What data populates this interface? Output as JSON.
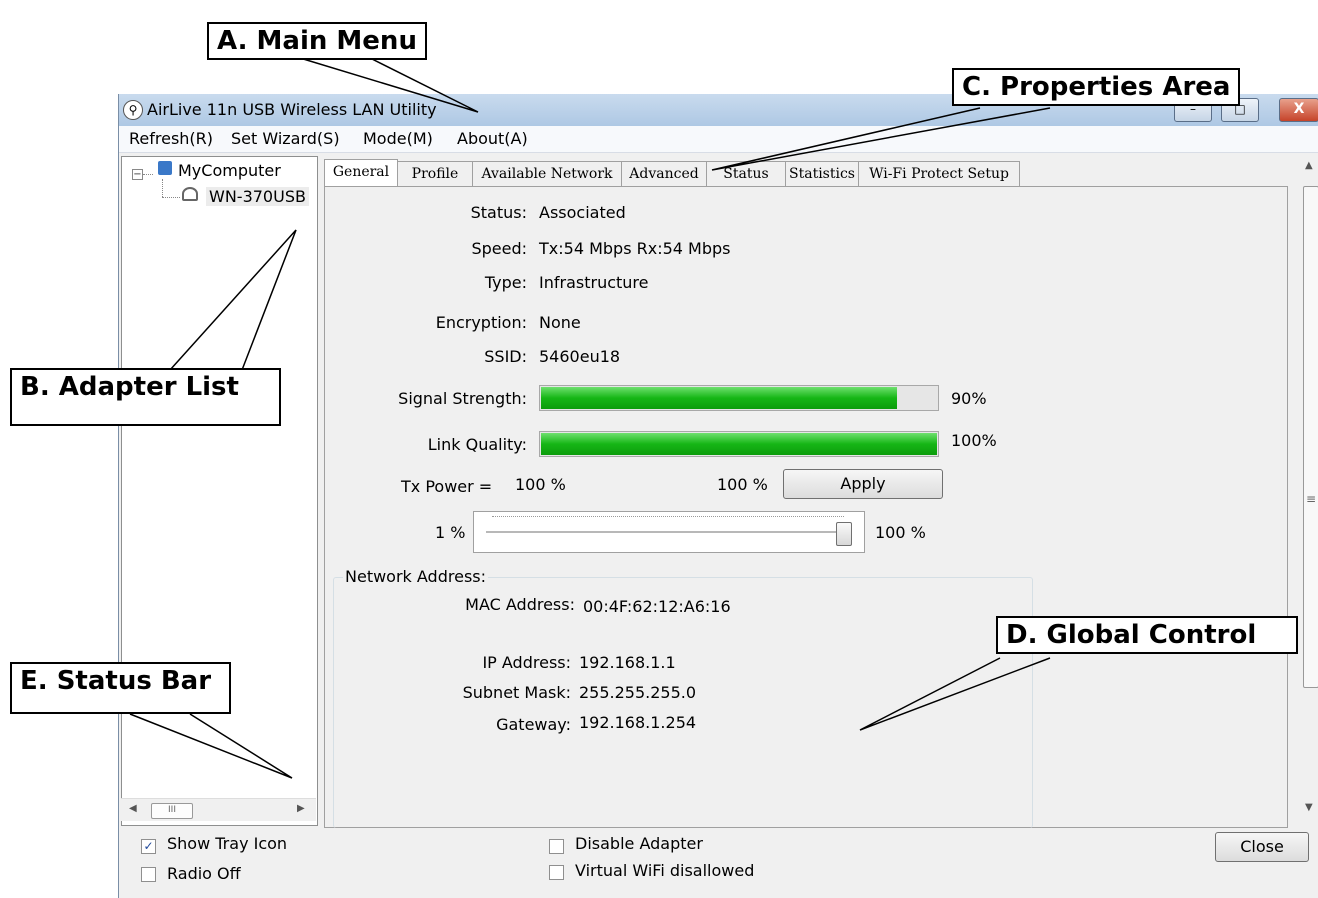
{
  "window": {
    "title": "AirLive 11n USB Wireless LAN Utility",
    "buttons": {
      "minimize": "–",
      "maximize": "□",
      "close": "X"
    }
  },
  "menu": [
    "Refresh(R)",
    "Set Wizard(S)",
    "Mode(M)",
    "About(A)"
  ],
  "tree": {
    "root": "MyComputer",
    "adapter": "WN-370USB",
    "scroll_thumb": "III"
  },
  "tabs": [
    "General",
    "Profile",
    "Available Network",
    "Advanced",
    "Status",
    "Statistics",
    "Wi-Fi Protect Setup"
  ],
  "general": {
    "status_label": "Status:",
    "status_value": "Associated",
    "speed_label": "Speed:",
    "speed_value": "Tx:54 Mbps Rx:54 Mbps",
    "type_label": "Type:",
    "type_value": "Infrastructure",
    "encryption_label": "Encryption:",
    "encryption_value": "None",
    "ssid_label": "SSID:",
    "ssid_value": "5460eu18",
    "signal_label": "Signal Strength:",
    "signal_text": "90%",
    "signal_level": 0.9,
    "link_label": "Link Quality:",
    "link_text": "100%",
    "link_level": 1.0,
    "txpower_label": "Tx Power =",
    "txpower_value": "100 %",
    "txpower_current": "100 %",
    "apply_label": "Apply",
    "slider_min": "1 %",
    "slider_max": "100 %",
    "slider_level": 1.0
  },
  "network": {
    "group_label": "Network Address:",
    "mac_label": "MAC Address:",
    "mac_value": "00:4F:62:12:A6:16",
    "ip_label": "IP Address:",
    "ip_value": "192.168.1.1",
    "subnet_label": "Subnet Mask:",
    "subnet_value": "255.255.255.0",
    "gateway_label": "Gateway:",
    "gateway_value": "192.168.1.254"
  },
  "global": {
    "show_tray": "Show Tray Icon",
    "show_tray_checked": true,
    "radio_off": "Radio Off",
    "radio_off_checked": false,
    "disable_adapter": "Disable Adapter",
    "disable_adapter_checked": false,
    "virtual_wifi": "Virtual WiFi disallowed",
    "virtual_wifi_checked": false,
    "close_label": "Close"
  },
  "callouts": {
    "a": "A. Main Menu",
    "b": "B. Adapter List",
    "c": "C. Properties Area",
    "d": "D. Global Control",
    "e": "E. Status Bar"
  },
  "colors": {
    "bar_green": "#16b616",
    "titlebar": "#aec8e4",
    "close_red": "#c6442a"
  }
}
